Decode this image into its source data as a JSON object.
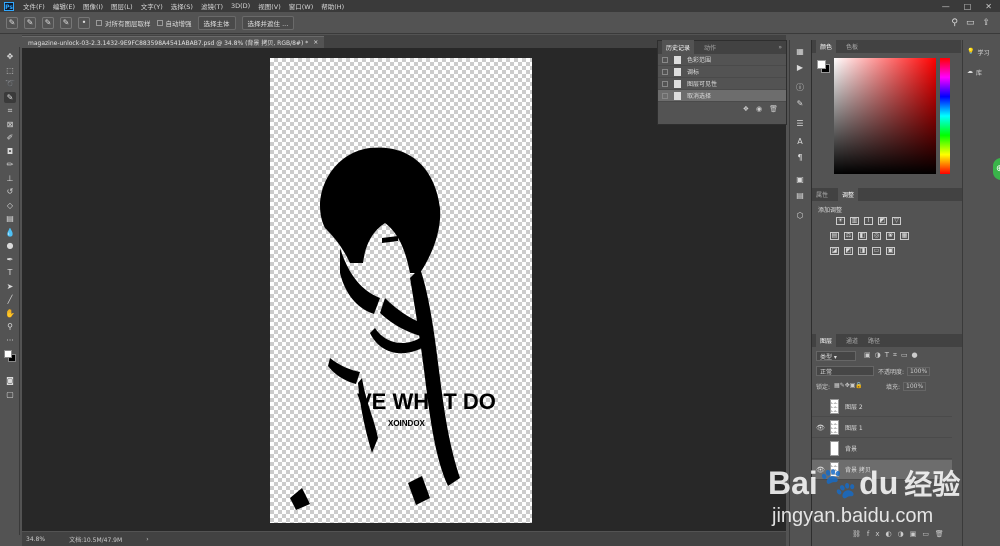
{
  "menubar": {
    "logo": "Ps",
    "items": [
      "文件(F)",
      "编辑(E)",
      "图像(I)",
      "图层(L)",
      "文字(Y)",
      "选择(S)",
      "滤镜(T)",
      "3D(D)",
      "视图(V)",
      "窗口(W)",
      "帮助(H)"
    ],
    "controls": [
      "—",
      "□",
      "✕"
    ]
  },
  "options": {
    "sample_all_layers": "对所有图层取样",
    "auto_enhance": "自动增强",
    "select_subject": "选择主体",
    "select_and_mask": "选择并遮住 ..."
  },
  "document": {
    "tab_title": "magazine-unlock-03-2.3.1432-9E9FC883598A4541ABAB7.psd @ 34.8% (背景 拷贝, RGB/8#) *",
    "close": "×"
  },
  "status": {
    "zoom": "34.8%",
    "doc_size": "文档:10.5M/47.9M",
    "arrow": "›"
  },
  "history": {
    "tabs": [
      "历史记录",
      "动作"
    ],
    "rows": [
      "色彩范围",
      "调标",
      "图层可见性",
      "取消选择"
    ],
    "selected_index": 3
  },
  "color_panel": {
    "tabs": [
      "颜色",
      "色板"
    ]
  },
  "adjust_panel": {
    "tabs": [
      "属性",
      "调整"
    ],
    "heading": "添加调整"
  },
  "layers_panel": {
    "tabs": [
      "图层",
      "通道",
      "路径"
    ],
    "kind": "类型",
    "blend": "正常",
    "opacity_label": "不透明度:",
    "opacity": "100%",
    "lock_label": "锁定:",
    "fill_label": "填充:",
    "fill": "100%",
    "layers": [
      {
        "name": "图层 2",
        "visible": false
      },
      {
        "name": "图层 1",
        "visible": true
      },
      {
        "name": "背景",
        "visible": false
      },
      {
        "name": "背景 拷贝",
        "visible": true
      }
    ]
  },
  "learn": {
    "label": "学习",
    "libraries": "库"
  },
  "watermark": {
    "brand": "Bai",
    "brand2": "du",
    "cn": "经验",
    "url": "jingyan.baidu.com"
  },
  "artwork": {
    "shirt_text": "VE WHAT  DO",
    "shirt_sub": "XOINDOX"
  },
  "colors": {
    "bg": "#535353",
    "canvas": "#282828",
    "accent": "#31a8ff",
    "green": "#3ab54a"
  }
}
